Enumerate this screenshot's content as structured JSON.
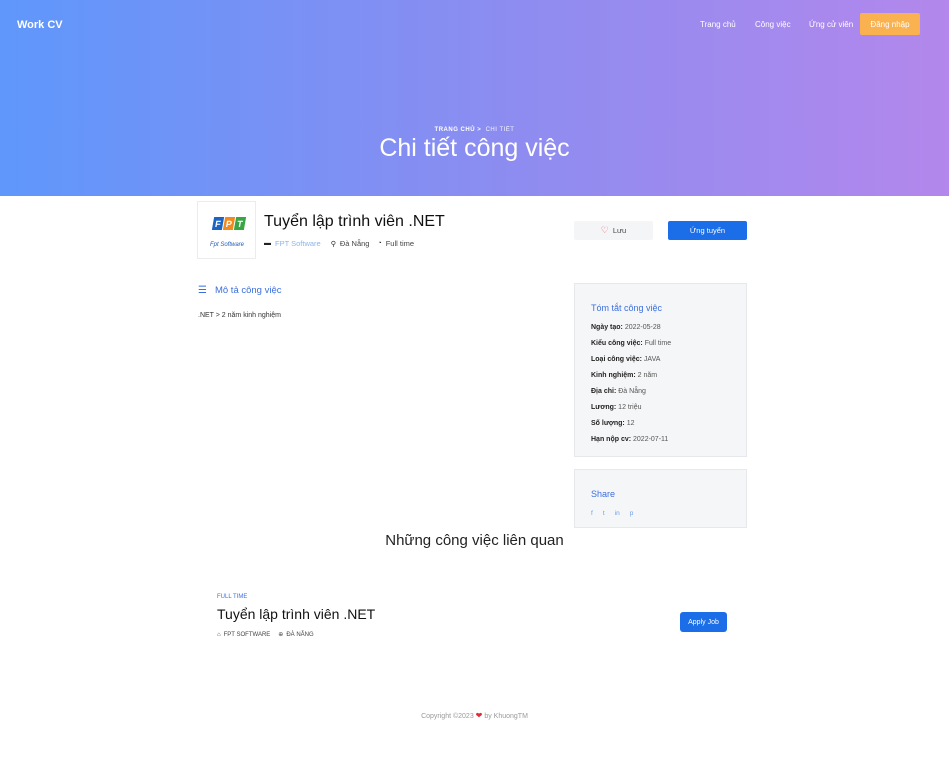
{
  "header": {
    "brand": "Work CV",
    "nav": [
      "Trang chủ",
      "Công việc",
      "Ứng cử viên"
    ],
    "login_label": "Đăng nhập",
    "breadcrumb": {
      "home": "TRANG CHỦ",
      "separator": ">",
      "current": "CHI TIẾT"
    },
    "title": "Chi tiết công việc"
  },
  "job": {
    "logo": {
      "letters": [
        "F",
        "P",
        "T"
      ],
      "caption": "Fpt Software"
    },
    "title": "Tuyển lập trình viên .NET",
    "company": "FPT Software",
    "location": "Đà Nẵng",
    "type": "Full time",
    "save_label": "Lưu",
    "apply_label": "Ứng tuyển"
  },
  "description": {
    "heading": "Mô tả công việc",
    "text": ".NET > 2 năm kinh nghiệm"
  },
  "summary": {
    "heading": "Tóm tắt công việc",
    "rows": [
      {
        "label": "Ngày tạo:",
        "value": "2022-05-28"
      },
      {
        "label": "Kiểu công việc:",
        "value": "Full time"
      },
      {
        "label": "Loại công việc:",
        "value": "JAVA"
      },
      {
        "label": "Kinh nghiệm:",
        "value": "2 năm"
      },
      {
        "label": "Địa chỉ:",
        "value": "Đà Nẵng"
      },
      {
        "label": "Lương:",
        "value": "12 triệu"
      },
      {
        "label": "Số lượng:",
        "value": "12"
      },
      {
        "label": "Hạn nộp cv:",
        "value": "2022-07-11"
      }
    ]
  },
  "share": {
    "heading": "Share",
    "icons": {
      "facebook": "f",
      "twitter": "t",
      "linkedin": "in",
      "pinterest": "p"
    }
  },
  "related": {
    "heading": "Những công việc liên quan",
    "items": [
      {
        "tag": "FULL TIME",
        "title": "Tuyển lập trình viên .NET",
        "company": "FPT SOFTWARE",
        "location": "ĐÀ NẴNG",
        "apply_label": "Apply Job"
      }
    ]
  },
  "footer": {
    "prefix": "Copyright ©2023",
    "suffix": "by KhuongTM"
  },
  "colors": {
    "accent": "#1b6de8",
    "login": "#f9b24f",
    "link": "#3b6fe0",
    "gradient_start": "#5f97fb",
    "gradient_end": "#b387ec"
  }
}
